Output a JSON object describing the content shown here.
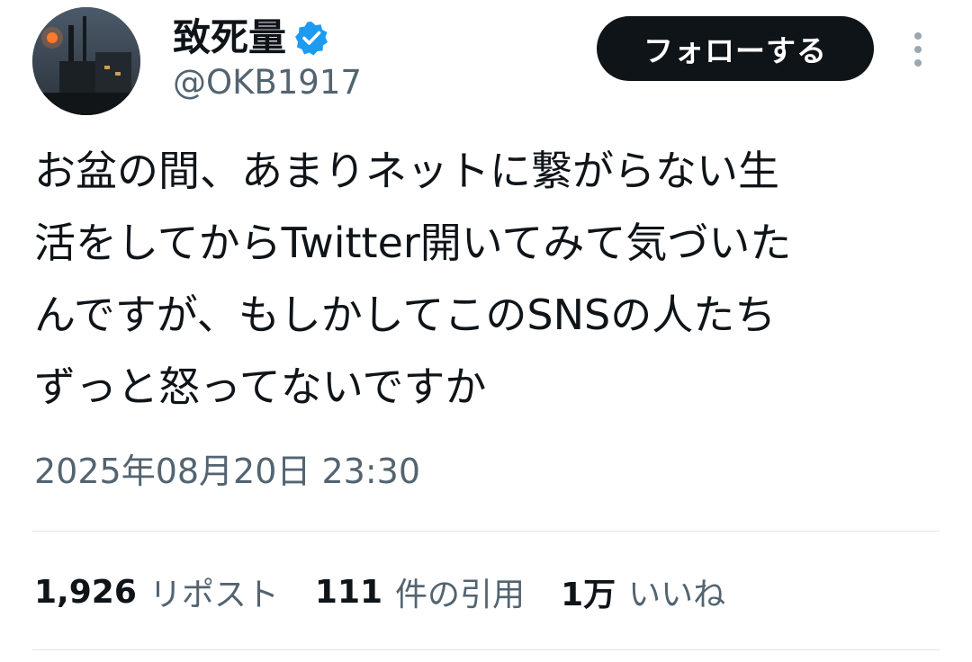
{
  "tweet": {
    "author": {
      "display_name": "致死量",
      "handle": "@OKB1917",
      "verified": true,
      "verified_icon": "verified-badge-icon",
      "avatar": "avatar-night-factory"
    },
    "follow_label": "フォローする",
    "more_icon": "more-vertical-icon",
    "text_lines": [
      "お盆の間、あまりネットに繋がらない生",
      "活をしてからTwitter開いてみて気づいた",
      "んですが、もしかしてこのSNSの人たち",
      "ずっと怒ってないですか"
    ],
    "timestamp": "2025年08月20日 23:30",
    "stats": {
      "reposts": {
        "count": "1,926",
        "label": "リポスト"
      },
      "quotes": {
        "count": "111",
        "label": "件の引用"
      },
      "likes": {
        "count": "1万",
        "label": "いいね"
      }
    }
  },
  "colors": {
    "text_primary": "#0f1419",
    "text_secondary": "#536471",
    "verified_blue": "#1d9bf0",
    "button_bg": "#0f1419",
    "divider": "#e1e6ea"
  }
}
